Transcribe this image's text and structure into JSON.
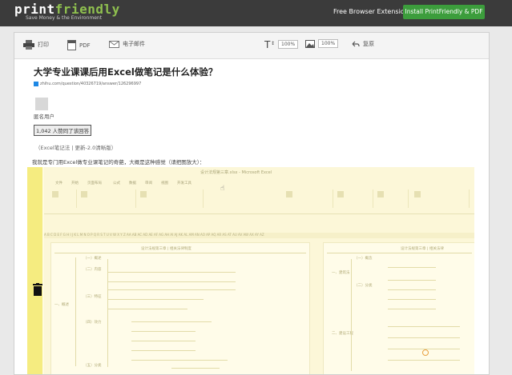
{
  "brand": {
    "logo_print": "print",
    "logo_friendly": "friendly",
    "tagline": "Save Money & the Environment",
    "free_text": "Free  Browser Extension!",
    "install_label": "Install PrintFriendly & PDF"
  },
  "toolbar": {
    "print_label": "打印",
    "pdf_label": "PDF",
    "email_label": "电子邮件",
    "text_size": "100%",
    "image_size": "100%",
    "undo_label": "复原"
  },
  "article": {
    "title": "大学专业课课后用Excel做笔记是什么体验？",
    "source_url": "zhihu.com/question/40326719/answer/126296997",
    "username": "匿名用户",
    "votes": "1,042 人赞同了该回答",
    "subnote": "（Excel笔记法 | 更新-2.0清晰版）",
    "para": "我就是专门用Excel做专业课笔记的奇葩，大概是这种感觉（请把图放大）："
  },
  "screenshot": {
    "window_title": "设计法规第三章.xlsx - Microsoft Excel",
    "tabs": [
      "文件",
      "开始",
      "页面布局",
      "公式",
      "数据",
      "审阅",
      "视图",
      "开发工具"
    ],
    "left_heading": "设计法规第三章  |  相关法律制度",
    "right_heading": "设计法规第三章  |  相关法律",
    "left_nodes": [
      "（一）概述",
      "（二）内容",
      "（三）特征",
      "（四）效力",
      "（五）分类"
    ],
    "left_root": "一、概述",
    "right_nodes": [
      "（一）概念",
      "（二）分类",
      "一、建筑法",
      "二、建设工程"
    ],
    "ruler_text": "A  B  C  D  E  F  G  H  I  J  K  L  M  N  O  P  Q  R  S  T  U  V  W  X  Y  Z  AA AB AC AD AE AF AG AH AI AJ AK AL AM AN AO AP AQ AR AS AT AU AV AW AX AY AZ"
  }
}
